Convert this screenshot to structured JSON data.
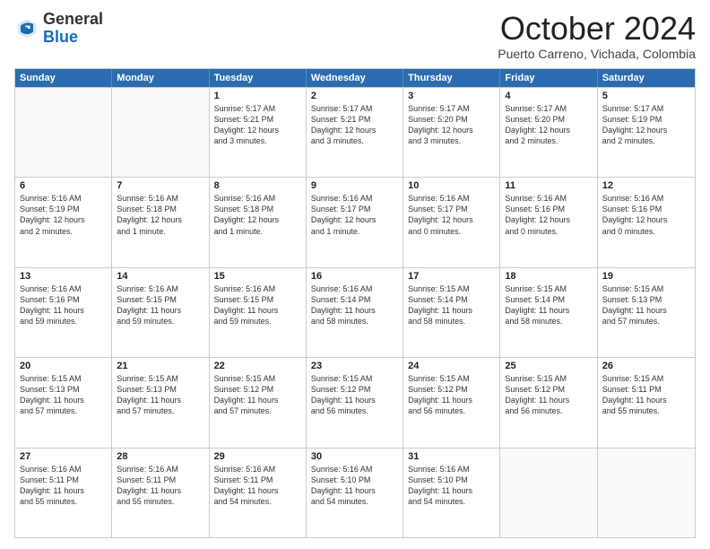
{
  "header": {
    "logo_general": "General",
    "logo_blue": "Blue",
    "month_title": "October 2024",
    "location": "Puerto Carreno, Vichada, Colombia"
  },
  "days_of_week": [
    "Sunday",
    "Monday",
    "Tuesday",
    "Wednesday",
    "Thursday",
    "Friday",
    "Saturday"
  ],
  "weeks": [
    [
      {
        "day": "",
        "empty": true
      },
      {
        "day": "",
        "empty": true
      },
      {
        "day": "1",
        "lines": [
          "Sunrise: 5:17 AM",
          "Sunset: 5:21 PM",
          "Daylight: 12 hours",
          "and 3 minutes."
        ]
      },
      {
        "day": "2",
        "lines": [
          "Sunrise: 5:17 AM",
          "Sunset: 5:21 PM",
          "Daylight: 12 hours",
          "and 3 minutes."
        ]
      },
      {
        "day": "3",
        "lines": [
          "Sunrise: 5:17 AM",
          "Sunset: 5:20 PM",
          "Daylight: 12 hours",
          "and 3 minutes."
        ]
      },
      {
        "day": "4",
        "lines": [
          "Sunrise: 5:17 AM",
          "Sunset: 5:20 PM",
          "Daylight: 12 hours",
          "and 2 minutes."
        ]
      },
      {
        "day": "5",
        "lines": [
          "Sunrise: 5:17 AM",
          "Sunset: 5:19 PM",
          "Daylight: 12 hours",
          "and 2 minutes."
        ]
      }
    ],
    [
      {
        "day": "6",
        "lines": [
          "Sunrise: 5:16 AM",
          "Sunset: 5:19 PM",
          "Daylight: 12 hours",
          "and 2 minutes."
        ]
      },
      {
        "day": "7",
        "lines": [
          "Sunrise: 5:16 AM",
          "Sunset: 5:18 PM",
          "Daylight: 12 hours",
          "and 1 minute."
        ]
      },
      {
        "day": "8",
        "lines": [
          "Sunrise: 5:16 AM",
          "Sunset: 5:18 PM",
          "Daylight: 12 hours",
          "and 1 minute."
        ]
      },
      {
        "day": "9",
        "lines": [
          "Sunrise: 5:16 AM",
          "Sunset: 5:17 PM",
          "Daylight: 12 hours",
          "and 1 minute."
        ]
      },
      {
        "day": "10",
        "lines": [
          "Sunrise: 5:16 AM",
          "Sunset: 5:17 PM",
          "Daylight: 12 hours",
          "and 0 minutes."
        ]
      },
      {
        "day": "11",
        "lines": [
          "Sunrise: 5:16 AM",
          "Sunset: 5:16 PM",
          "Daylight: 12 hours",
          "and 0 minutes."
        ]
      },
      {
        "day": "12",
        "lines": [
          "Sunrise: 5:16 AM",
          "Sunset: 5:16 PM",
          "Daylight: 12 hours",
          "and 0 minutes."
        ]
      }
    ],
    [
      {
        "day": "13",
        "lines": [
          "Sunrise: 5:16 AM",
          "Sunset: 5:16 PM",
          "Daylight: 11 hours",
          "and 59 minutes."
        ]
      },
      {
        "day": "14",
        "lines": [
          "Sunrise: 5:16 AM",
          "Sunset: 5:15 PM",
          "Daylight: 11 hours",
          "and 59 minutes."
        ]
      },
      {
        "day": "15",
        "lines": [
          "Sunrise: 5:16 AM",
          "Sunset: 5:15 PM",
          "Daylight: 11 hours",
          "and 59 minutes."
        ]
      },
      {
        "day": "16",
        "lines": [
          "Sunrise: 5:16 AM",
          "Sunset: 5:14 PM",
          "Daylight: 11 hours",
          "and 58 minutes."
        ]
      },
      {
        "day": "17",
        "lines": [
          "Sunrise: 5:15 AM",
          "Sunset: 5:14 PM",
          "Daylight: 11 hours",
          "and 58 minutes."
        ]
      },
      {
        "day": "18",
        "lines": [
          "Sunrise: 5:15 AM",
          "Sunset: 5:14 PM",
          "Daylight: 11 hours",
          "and 58 minutes."
        ]
      },
      {
        "day": "19",
        "lines": [
          "Sunrise: 5:15 AM",
          "Sunset: 5:13 PM",
          "Daylight: 11 hours",
          "and 57 minutes."
        ]
      }
    ],
    [
      {
        "day": "20",
        "lines": [
          "Sunrise: 5:15 AM",
          "Sunset: 5:13 PM",
          "Daylight: 11 hours",
          "and 57 minutes."
        ]
      },
      {
        "day": "21",
        "lines": [
          "Sunrise: 5:15 AM",
          "Sunset: 5:13 PM",
          "Daylight: 11 hours",
          "and 57 minutes."
        ]
      },
      {
        "day": "22",
        "lines": [
          "Sunrise: 5:15 AM",
          "Sunset: 5:12 PM",
          "Daylight: 11 hours",
          "and 57 minutes."
        ]
      },
      {
        "day": "23",
        "lines": [
          "Sunrise: 5:15 AM",
          "Sunset: 5:12 PM",
          "Daylight: 11 hours",
          "and 56 minutes."
        ]
      },
      {
        "day": "24",
        "lines": [
          "Sunrise: 5:15 AM",
          "Sunset: 5:12 PM",
          "Daylight: 11 hours",
          "and 56 minutes."
        ]
      },
      {
        "day": "25",
        "lines": [
          "Sunrise: 5:15 AM",
          "Sunset: 5:12 PM",
          "Daylight: 11 hours",
          "and 56 minutes."
        ]
      },
      {
        "day": "26",
        "lines": [
          "Sunrise: 5:15 AM",
          "Sunset: 5:11 PM",
          "Daylight: 11 hours",
          "and 55 minutes."
        ]
      }
    ],
    [
      {
        "day": "27",
        "lines": [
          "Sunrise: 5:16 AM",
          "Sunset: 5:11 PM",
          "Daylight: 11 hours",
          "and 55 minutes."
        ]
      },
      {
        "day": "28",
        "lines": [
          "Sunrise: 5:16 AM",
          "Sunset: 5:11 PM",
          "Daylight: 11 hours",
          "and 55 minutes."
        ]
      },
      {
        "day": "29",
        "lines": [
          "Sunrise: 5:16 AM",
          "Sunset: 5:11 PM",
          "Daylight: 11 hours",
          "and 54 minutes."
        ]
      },
      {
        "day": "30",
        "lines": [
          "Sunrise: 5:16 AM",
          "Sunset: 5:10 PM",
          "Daylight: 11 hours",
          "and 54 minutes."
        ]
      },
      {
        "day": "31",
        "lines": [
          "Sunrise: 5:16 AM",
          "Sunset: 5:10 PM",
          "Daylight: 11 hours",
          "and 54 minutes."
        ]
      },
      {
        "day": "",
        "empty": true
      },
      {
        "day": "",
        "empty": true
      }
    ]
  ]
}
